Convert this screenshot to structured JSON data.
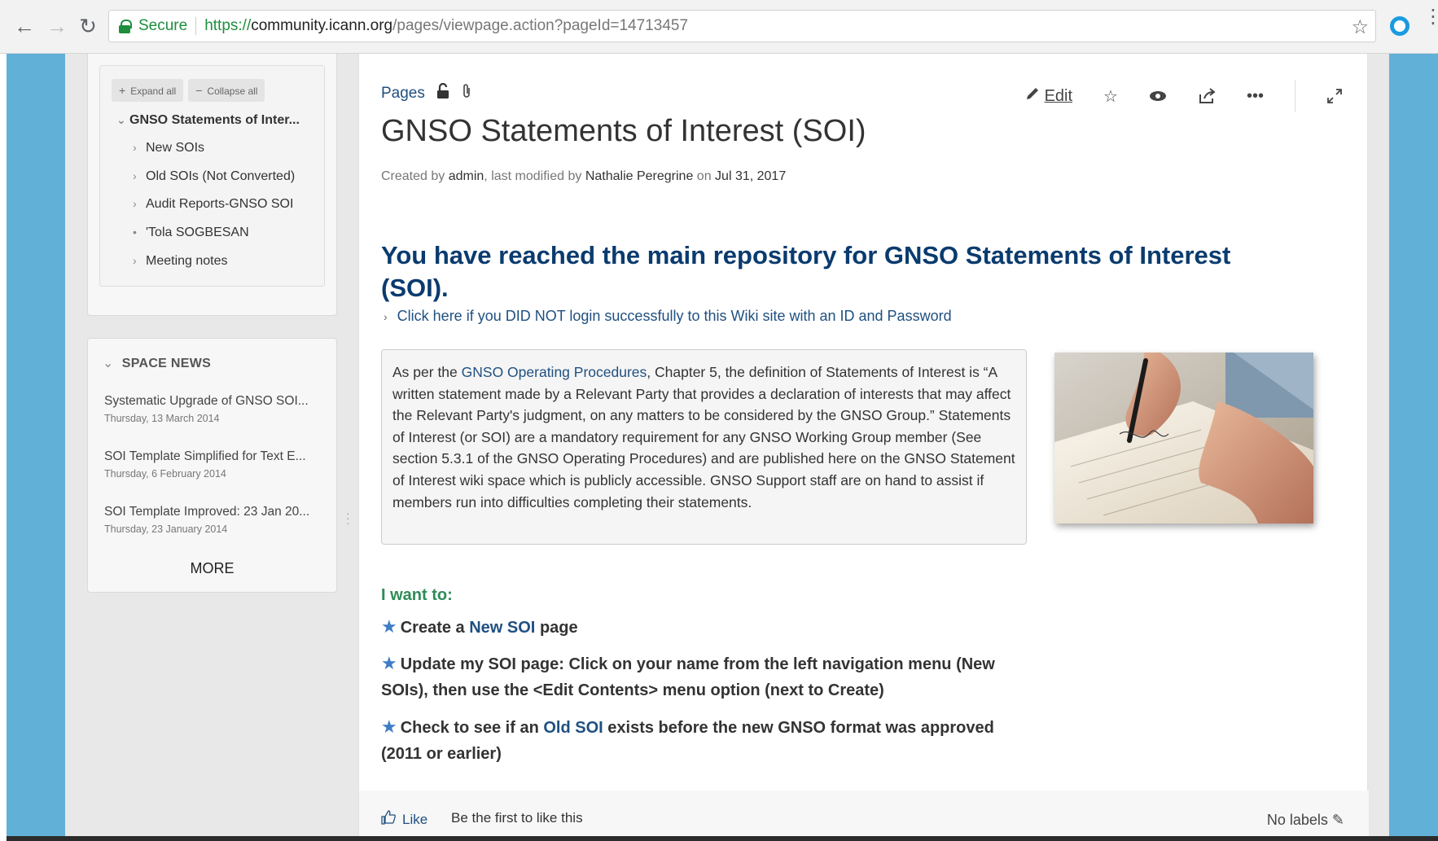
{
  "browser": {
    "secure_label": "Secure",
    "url_scheme": "https://",
    "url_host": "community.icann.org",
    "url_path": "/pages/viewpage.action?pageId=14713457"
  },
  "sidebar": {
    "expand_all": "Expand all",
    "collapse_all": "Collapse all",
    "root": "GNSO Statements of Inter...",
    "children": [
      {
        "label": "New SOIs",
        "marker": "›"
      },
      {
        "label": "Old SOIs (Not Converted)",
        "marker": "›"
      },
      {
        "label": "Audit Reports-GNSO SOI",
        "marker": "›"
      },
      {
        "label": "'Tola SOGBESAN",
        "marker": "•"
      },
      {
        "label": "Meeting notes",
        "marker": "›"
      }
    ],
    "space_news": {
      "title": "SPACE NEWS",
      "items": [
        {
          "title": "Systematic Upgrade of GNSO SOI...",
          "date": "Thursday, 13 March 2014"
        },
        {
          "title": "SOI Template Simplified for Text E...",
          "date": "Thursday, 6 February 2014"
        },
        {
          "title": "SOI Template Improved: 23 Jan 20...",
          "date": "Thursday, 23 January 2014"
        }
      ],
      "more": "MORE"
    }
  },
  "page": {
    "breadcrumb": "Pages",
    "toolbar_edit": "Edit",
    "title": "GNSO Statements of Interest (SOI)",
    "meta": {
      "created_by_label": "Created by",
      "creator": "admin",
      "modified_label": ", last modified by",
      "modifier": "Nathalie Peregrine",
      "on_label": "on",
      "date": "Jul 31, 2017"
    },
    "heading": "You have reached the main repository for GNSO Statements of Interest (SOI).",
    "expand_link": "Click here if you DID NOT login successfully to this Wiki site with an ID and Password",
    "panel": {
      "prefix": "As per the",
      "link": "GNSO Operating Procedures",
      "body": ", Chapter 5, the definition of Statements of Interest is “A written statement made by a Relevant Party that provides a declaration of interests that may affect the Relevant Party's judgment, on any matters to be considered by the GNSO Group.” Statements of Interest (or SOI) are a mandatory requirement for any GNSO Working Group member (See section 5.3.1 of the GNSO Operating Procedures) and are published here on the GNSO Statement of Interest wiki space which is publicly accessible. GNSO Support staff are on hand to assist if members run into difficulties completing their statements."
    },
    "want_heading": "I want to:",
    "bullets": {
      "b1_pre": "Create a",
      "b1_link": "New SOI",
      "b1_post": "page",
      "b2": "Update my SOI page: Click on your name from the left navigation menu (New SOIs), then use the <Edit Contents> menu option (next to Create)",
      "b3_pre": "Check to see if an",
      "b3_link": "Old SOI",
      "b3_post": "exists before the new GNSO format was approved (2011 or earlier)"
    },
    "footer": {
      "like": "Like",
      "like_text": "Be the first to like this",
      "labels": "No labels"
    }
  },
  "colors": {
    "link": "#205081",
    "heading": "#0a3b6e",
    "want": "#2e8b57",
    "star": "#3e7dc5",
    "background": "#60b0d8"
  },
  "icons": [
    "back-icon",
    "forward-icon",
    "reload-icon",
    "lock-icon",
    "bookmark-star-icon",
    "extension-icon",
    "menu-icon",
    "unlock-icon",
    "paperclip-icon",
    "pencil-icon",
    "star-icon",
    "eye-icon",
    "share-icon",
    "more-icon",
    "fullscreen-icon",
    "thumbs-up-icon"
  ]
}
